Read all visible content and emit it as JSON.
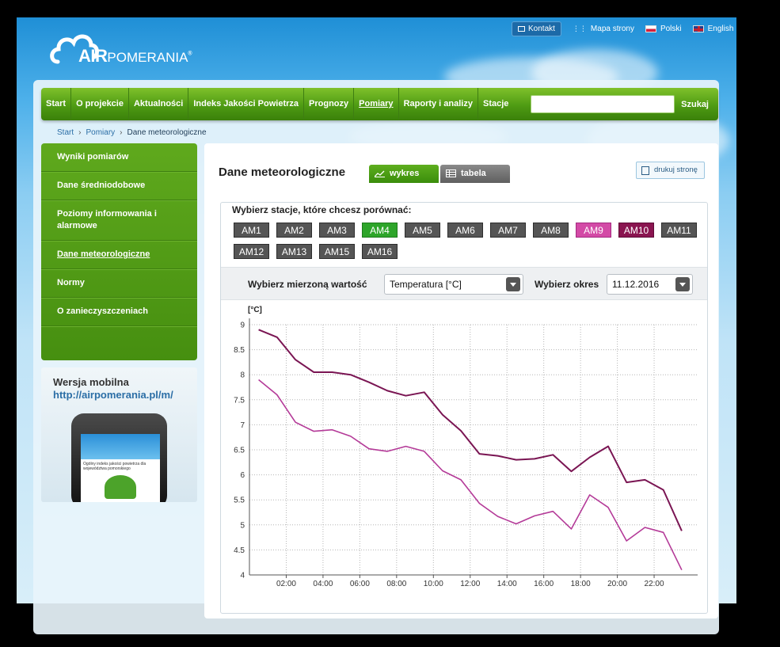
{
  "toplinks": {
    "kontakt": "Kontakt",
    "mapa": "Mapa strony",
    "polski": "Polski",
    "english": "English"
  },
  "logo": {
    "air": "AIR",
    "pomerania": "POMERANIA",
    "reg": "®"
  },
  "nav": {
    "items": [
      "Start",
      "O projekcie",
      "Aktualności",
      "Indeks Jakości Powietrza",
      "Prognozy",
      "Pomiary",
      "Raporty i analizy",
      "Stacje"
    ],
    "search_label": "Szukaj",
    "search_value": ""
  },
  "breadcrumb": {
    "start": "Start",
    "pomiary": "Pomiary",
    "current": "Dane meteorologiczne"
  },
  "sidebar": {
    "items": [
      "Wyniki pomiarów",
      "Dane średniodobowe",
      "Poziomy informowania i alarmowe",
      "Dane meteorologiczne",
      "Normy",
      "O zanieczyszczeniach"
    ]
  },
  "mobile": {
    "title": "Wersja mobilna",
    "url": "http://airpomerania.pl/m/",
    "screen_text": "Ogólny indeks jakości powietrza dla województwa pomorskiego"
  },
  "page": {
    "title": "Dane meteorologiczne",
    "tab_chart": "wykres",
    "tab_table": "tabela",
    "print": "drukuj stronę"
  },
  "stations": {
    "label": "Wybierz stacje, które chcesz porównać:",
    "buttons": [
      "AM1",
      "AM2",
      "AM3",
      "AM4",
      "AM5",
      "AM6",
      "AM7",
      "AM8",
      "AM9",
      "AM10",
      "AM11",
      "AM12",
      "AM13",
      "AM15",
      "AM16"
    ],
    "states": {
      "AM4": "green",
      "AM9": "pink",
      "AM10": "purple"
    }
  },
  "filters": {
    "measure_label": "Wybierz mierzoną wartość",
    "measure_value": "Temperatura [°C]",
    "period_label": "Wybierz okres",
    "period_value": "11.12.2016"
  },
  "colors": {
    "series_am10": "#7a1553",
    "series_am9": "#b43a98",
    "nav_green": "#4e9b13"
  },
  "chart_data": {
    "type": "line",
    "ylabel": "[°C]",
    "ylim": [
      4,
      9
    ],
    "yticks": [
      4,
      4.5,
      5,
      5.5,
      6,
      6.5,
      7,
      7.5,
      8,
      8.5,
      9
    ],
    "xticks": [
      "02:00",
      "04:00",
      "06:00",
      "08:00",
      "10:00",
      "12:00",
      "14:00",
      "16:00",
      "18:00",
      "20:00",
      "22:00"
    ],
    "x": [
      0,
      1,
      2,
      3,
      4,
      5,
      6,
      7,
      8,
      9,
      10,
      11,
      12,
      13,
      14,
      15,
      16,
      17,
      18,
      19,
      20,
      21,
      22,
      23
    ],
    "grid": true,
    "series": [
      {
        "name": "AM10",
        "values": [
          8.9,
          8.75,
          8.3,
          8.05,
          8.05,
          8.0,
          7.85,
          7.68,
          7.58,
          7.65,
          7.2,
          6.88,
          6.42,
          6.38,
          6.3,
          6.32,
          6.4,
          6.07,
          6.35,
          6.57,
          5.85,
          5.9,
          5.7,
          4.88
        ]
      },
      {
        "name": "AM9",
        "values": [
          7.9,
          7.6,
          7.05,
          6.87,
          6.9,
          6.77,
          6.52,
          6.47,
          6.57,
          6.47,
          6.08,
          5.9,
          5.43,
          5.17,
          5.02,
          5.18,
          5.27,
          4.92,
          5.6,
          5.35,
          4.68,
          4.95,
          4.85,
          4.1
        ]
      }
    ]
  }
}
